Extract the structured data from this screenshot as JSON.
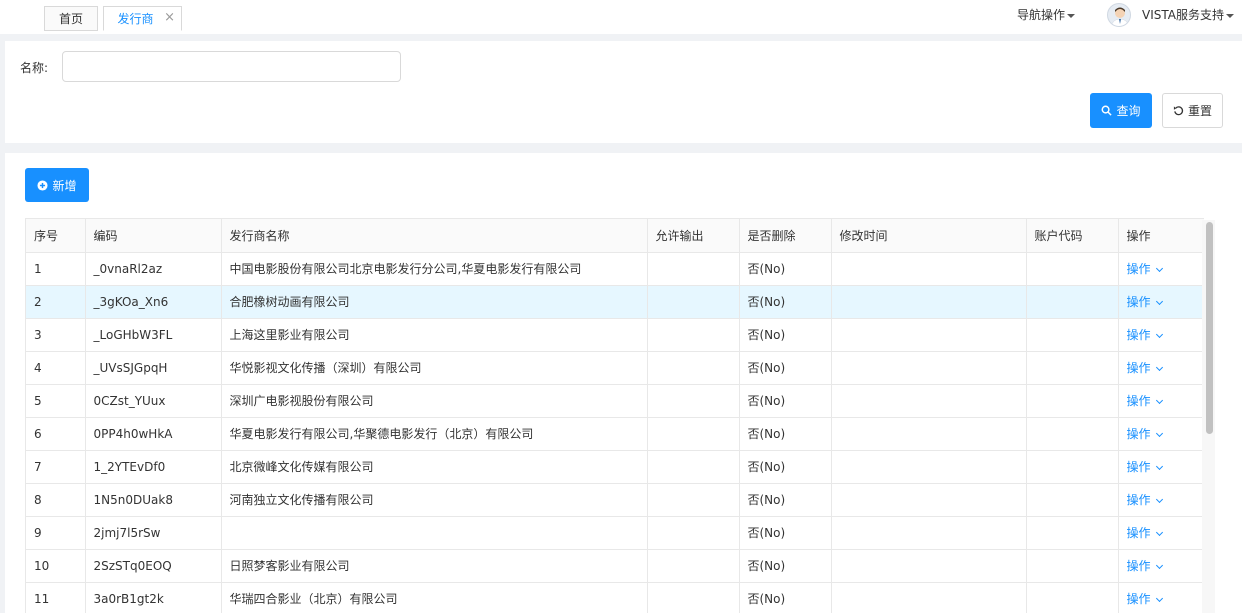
{
  "tabs": [
    {
      "label": "首页"
    },
    {
      "label": "发行商",
      "close": "×"
    }
  ],
  "header": {
    "nav_ops": "导航操作",
    "user_name": "VISTA服务支持"
  },
  "search": {
    "name_label": "名称:",
    "name_value": "",
    "query_label": "查询",
    "reset_label": "重置"
  },
  "toolbar": {
    "add_label": "新增"
  },
  "colors": {
    "primary": "#1890ff",
    "row_highlight": "#e6f7ff"
  },
  "table": {
    "columns": [
      "序号",
      "编码",
      "发行商名称",
      "允许输出",
      "是否删除",
      "修改时间",
      "账户代码",
      "操作"
    ],
    "rows": [
      {
        "no": "1",
        "code": "_0vnaRl2az",
        "name": "中国电影股份有限公司北京电影发行分公司,华夏电影发行有限公司",
        "allow": "",
        "deleted": "否(No)",
        "modified": "",
        "account": "",
        "op": "操作"
      },
      {
        "no": "2",
        "code": "_3gKOa_Xn6",
        "name": "合肥橡树动画有限公司",
        "allow": "",
        "deleted": "否(No)",
        "modified": "",
        "account": "",
        "op": "操作"
      },
      {
        "no": "3",
        "code": "_LoGHbW3FL",
        "name": "上海这里影业有限公司",
        "allow": "",
        "deleted": "否(No)",
        "modified": "",
        "account": "",
        "op": "操作"
      },
      {
        "no": "4",
        "code": "_UVsSJGpqH",
        "name": "华悦影视文化传播（深圳）有限公司",
        "allow": "",
        "deleted": "否(No)",
        "modified": "",
        "account": "",
        "op": "操作"
      },
      {
        "no": "5",
        "code": "0CZst_YUux",
        "name": "深圳广电影视股份有限公司",
        "allow": "",
        "deleted": "否(No)",
        "modified": "",
        "account": "",
        "op": "操作"
      },
      {
        "no": "6",
        "code": "0PP4h0wHkA",
        "name": "华夏电影发行有限公司,华聚德电影发行（北京）有限公司",
        "allow": "",
        "deleted": "否(No)",
        "modified": "",
        "account": "",
        "op": "操作"
      },
      {
        "no": "7",
        "code": "1_2YTEvDf0",
        "name": "北京微峰文化传媒有限公司",
        "allow": "",
        "deleted": "否(No)",
        "modified": "",
        "account": "",
        "op": "操作"
      },
      {
        "no": "8",
        "code": "1N5n0DUak8",
        "name": "河南独立文化传播有限公司",
        "allow": "",
        "deleted": "否(No)",
        "modified": "",
        "account": "",
        "op": "操作"
      },
      {
        "no": "9",
        "code": "2jmj7l5rSw",
        "name": "",
        "allow": "",
        "deleted": "否(No)",
        "modified": "",
        "account": "",
        "op": "操作"
      },
      {
        "no": "10",
        "code": "2SzSTq0EOQ",
        "name": "日照梦客影业有限公司",
        "allow": "",
        "deleted": "否(No)",
        "modified": "",
        "account": "",
        "op": "操作"
      },
      {
        "no": "11",
        "code": "3a0rB1gt2k",
        "name": "华瑞四合影业（北京）有限公司",
        "allow": "",
        "deleted": "否(No)",
        "modified": "",
        "account": "",
        "op": "操作"
      }
    ]
  }
}
